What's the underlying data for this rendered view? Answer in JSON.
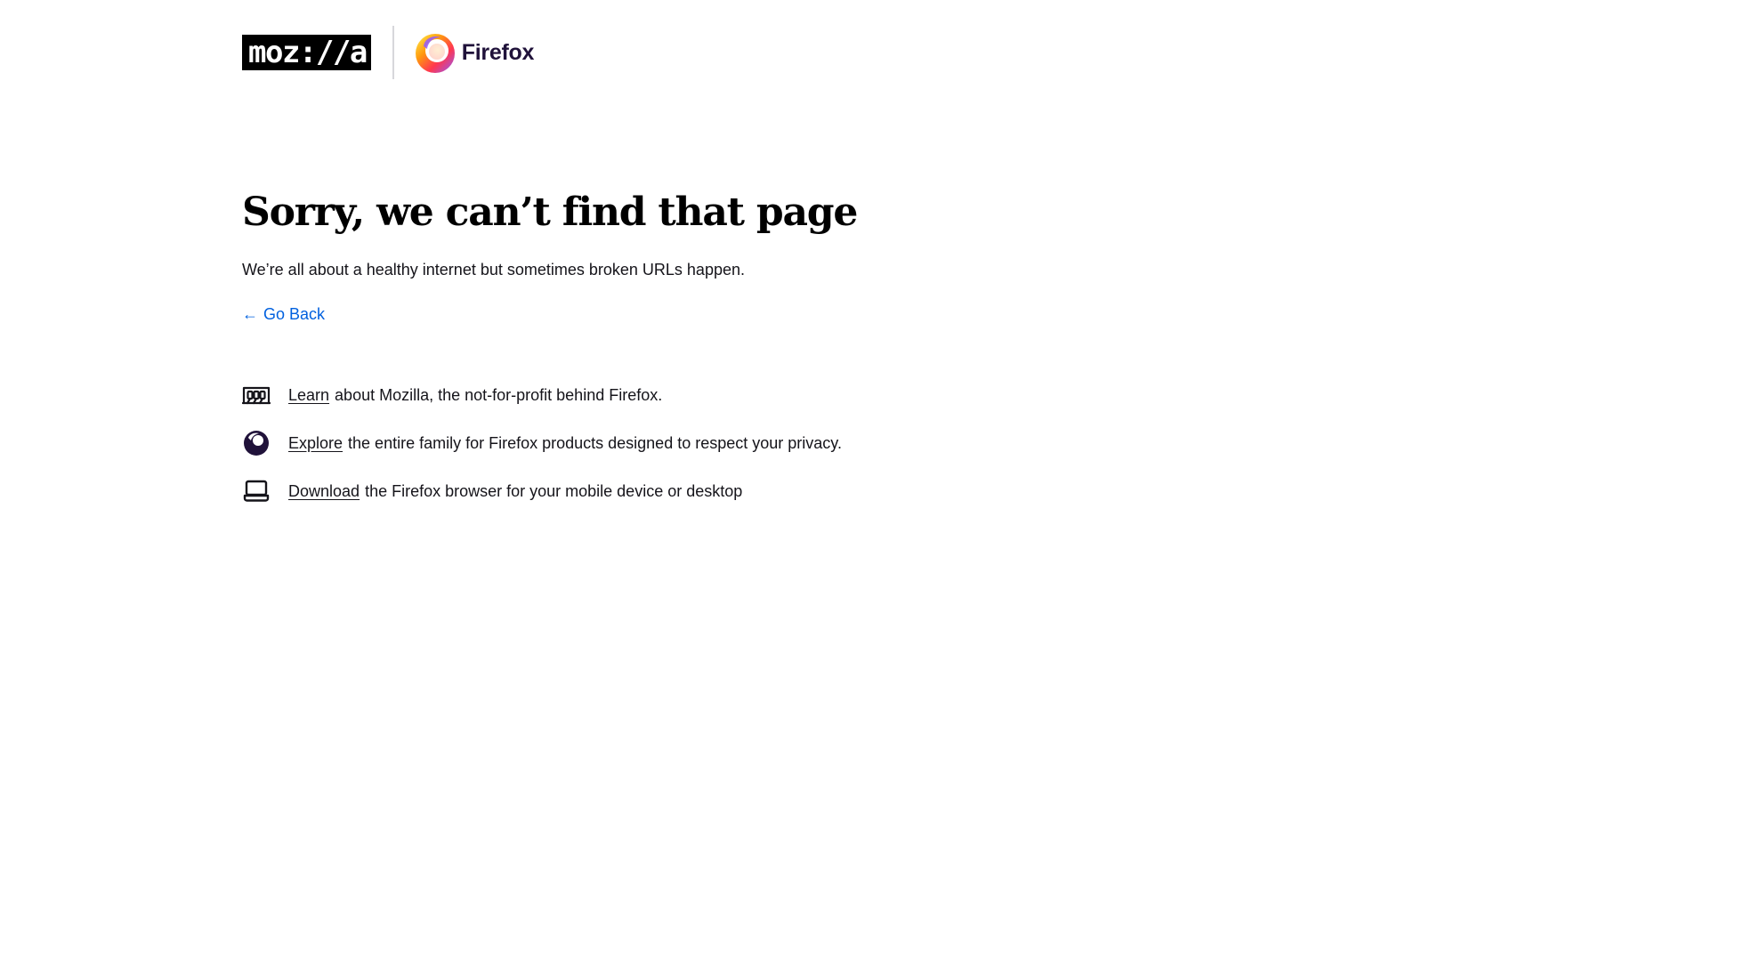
{
  "header": {
    "mozilla_logo": "moz://a",
    "firefox_wordmark": "Firefox"
  },
  "main": {
    "title": "Sorry, we can’t find that page",
    "subtitle": "We’re all about a healthy internet but sometimes broken URLs happen.",
    "go_back_arrow": "←",
    "go_back_label": "Go Back"
  },
  "links": [
    {
      "icon": "building-icon",
      "link_text": "Learn",
      "rest": "about Mozilla, the not-for-profit behind Firefox."
    },
    {
      "icon": "firefox-family-icon",
      "link_text": "Explore",
      "rest": "the entire family for Firefox products designed to respect your privacy."
    },
    {
      "icon": "laptop-icon",
      "link_text": "Download",
      "rest": "the Firefox browser for your mobile device or desktop"
    }
  ],
  "colors": {
    "link_blue": "#0060df",
    "text": "#15141a",
    "firefox_dark": "#20123a"
  }
}
